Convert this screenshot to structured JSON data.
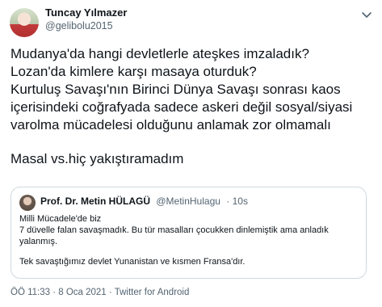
{
  "author": {
    "name": "Tuncay Yılmazer",
    "handle": "@gelibolu2015"
  },
  "tweet": {
    "lines": [
      "Mudanya'da hangi devletlerle ateşkes imzaladık?",
      "Lozan'da kimlere karşı masaya oturduk?",
      "Kurtuluş Savaşı'nın Birinci Dünya Savaşı sonrası kaos",
      "içerisindeki coğrafyada sadece askeri değil sosyal/siyasi",
      "varolma mücadelesi olduğunu anlamak zor olmamalı",
      "Masal vs.hiç yakıştıramadım"
    ]
  },
  "quoted": {
    "name": "Prof. Dr. Metin HÜLAGÜ",
    "handle": "@MetinHulagu",
    "time": "· 10s",
    "lines": [
      "Milli Mücadele'de biz",
      "7 düvelle falan savaşmadık. Bu tür masalları çocukken dinlemiştik ama anladık",
      "yalanmış.",
      "Tek savaştığımız devlet Yunanistan ve kısmen Fransa'dır."
    ]
  },
  "meta": {
    "timestamp": "ÖÖ 11:33 · 8 Oca 2021 · Twitter for Android"
  },
  "icons": {
    "more": "chevron-down-icon"
  }
}
